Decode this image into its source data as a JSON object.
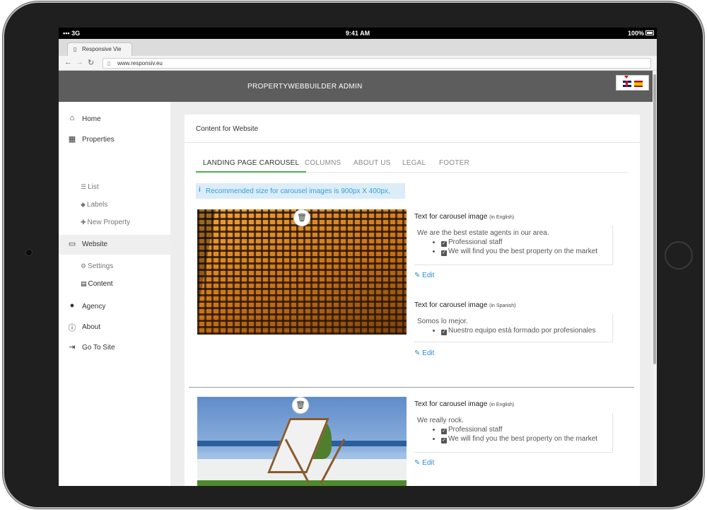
{
  "device": {
    "status": {
      "carrier": "3G",
      "time": "9:41 AM",
      "battery": "100%"
    },
    "browser": {
      "tab_title": "Responsive Vie",
      "url": "www.responsiv.eu"
    }
  },
  "header": {
    "title": "PROPERTYWEBBUILDER ADMIN",
    "languages": [
      "English",
      "Spanish"
    ]
  },
  "sidebar": {
    "items": [
      {
        "label": "Home",
        "icon": "home-icon"
      },
      {
        "label": "Properties",
        "icon": "building-icon"
      },
      {
        "label": "List",
        "icon": "list-icon"
      },
      {
        "label": "Labels",
        "icon": "tag-icon"
      },
      {
        "label": "New Property",
        "icon": "plus-icon"
      },
      {
        "label": "Website",
        "icon": "desktop-icon"
      },
      {
        "label": "Settings",
        "icon": "gear-icon"
      },
      {
        "label": "Content",
        "icon": "table-icon"
      },
      {
        "label": "Agency",
        "icon": "user-icon"
      },
      {
        "label": "About",
        "icon": "info-icon"
      },
      {
        "label": "Go To Site",
        "icon": "sign-out-icon"
      }
    ]
  },
  "main": {
    "title": "Content for Website",
    "tabs": [
      "LANDING PAGE CAROUSEL",
      "COLUMNS",
      "ABOUT US",
      "LEGAL",
      "FOOTER"
    ],
    "active_tab": "LANDING PAGE CAROUSEL",
    "info": "Recommended size for carousel images is 900px X 400px,",
    "slides": [
      {
        "captions": [
          {
            "label": "Text for carousel image",
            "lang": "(in English)",
            "lead": "We are the best estate agents in our area.",
            "bullets": [
              "Professional staff",
              "We will find you the best property on the market"
            ],
            "edit": "Edit"
          },
          {
            "label": "Text for carousel image",
            "lang": "(in Spanish)",
            "lead": "Somos lo mejor.",
            "bullets": [
              "Nuestro equipo está formado por profesionales"
            ],
            "edit": "Edit"
          }
        ]
      },
      {
        "captions": [
          {
            "label": "Text for carousel image",
            "lang": "(in English)",
            "lead": "We really rock.",
            "bullets": [
              "Professional staff",
              "We will find you the best property on the market"
            ],
            "edit": "Edit"
          }
        ]
      }
    ]
  },
  "colors": {
    "admin_bar": "#5d5d5d",
    "tab_active_underline": "#4caf50",
    "info_bg": "#dcecf8",
    "info_text": "#31a0d8",
    "link": "#2a8ad8"
  }
}
